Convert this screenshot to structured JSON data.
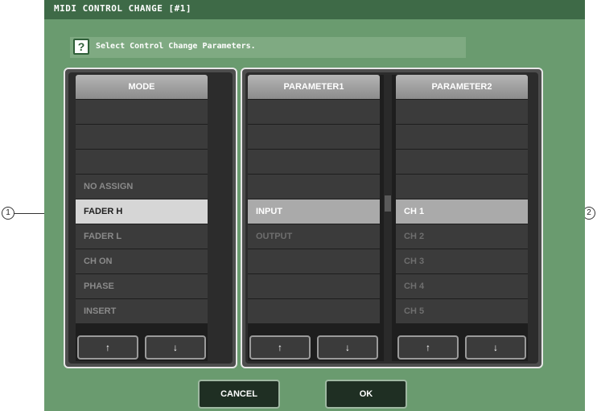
{
  "window": {
    "title": "MIDI CONTROL CHANGE   [#1]"
  },
  "instruction": {
    "icon": "help-icon",
    "glyph": "?",
    "text": "Select Control Change Parameters."
  },
  "mode": {
    "header": "MODE",
    "items": [
      "",
      "",
      "",
      "NO ASSIGN",
      "FADER H",
      "FADER L",
      "CH ON",
      "PHASE",
      "INSERT"
    ],
    "selected_index": 4,
    "up_glyph": "↑",
    "down_glyph": "↓"
  },
  "parameter1": {
    "header": "PARAMETER1",
    "items": [
      "",
      "",
      "",
      "",
      "INPUT",
      "OUTPUT",
      "",
      "",
      ""
    ],
    "selected_index": 4,
    "up_glyph": "↑",
    "down_glyph": "↓"
  },
  "parameter2": {
    "header": "PARAMETER2",
    "items": [
      "",
      "",
      "",
      "",
      "CH 1",
      "CH 2",
      "CH 3",
      "CH 4",
      "CH 5"
    ],
    "selected_index": 4,
    "up_glyph": "↑",
    "down_glyph": "↓"
  },
  "buttons": {
    "cancel": "CANCEL",
    "ok": "OK"
  },
  "callouts": {
    "left": "1",
    "right": "2"
  },
  "colors": {
    "dialog_bg": "#6a9b6f",
    "titlebar": "#3e6a47",
    "selected_row": "#d6d6d6",
    "row": "#3b3b3b"
  }
}
